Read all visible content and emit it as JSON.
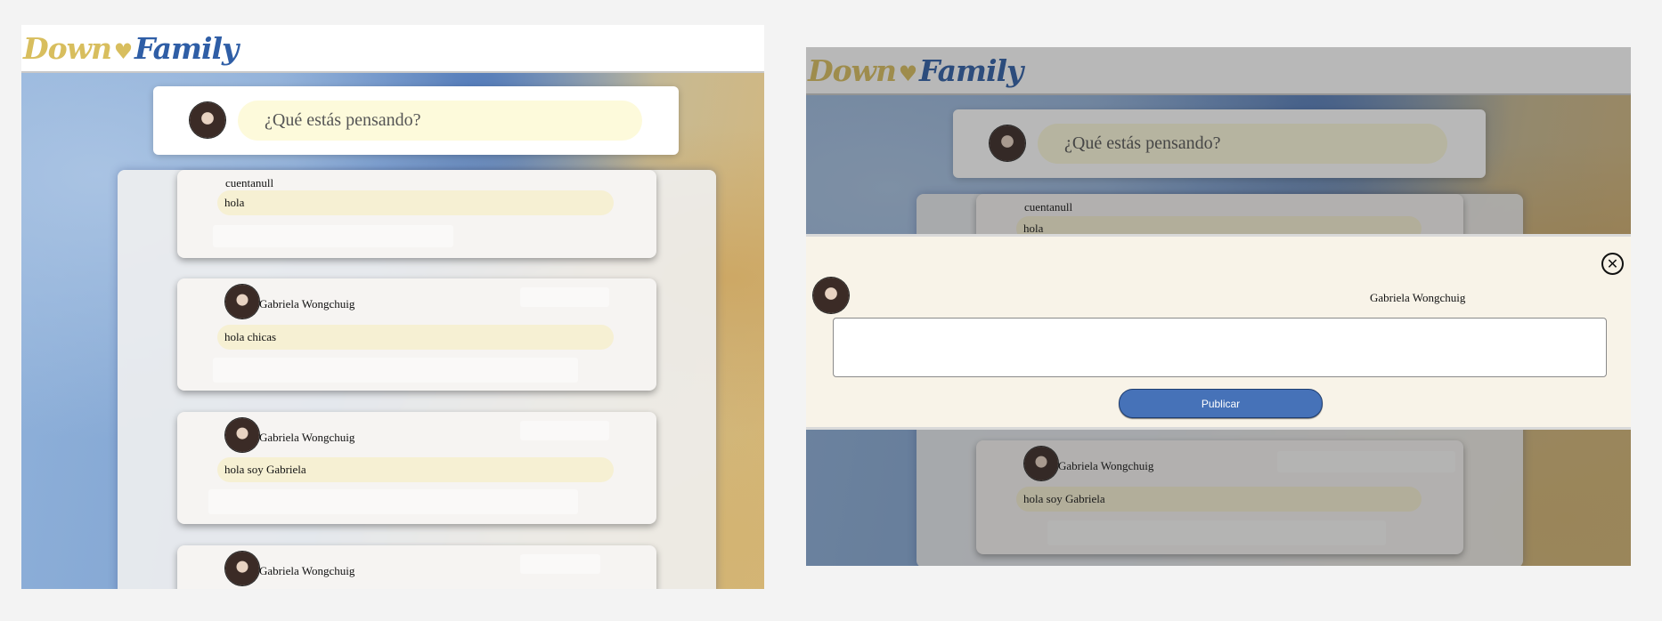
{
  "app": {
    "logo": {
      "part1": "Down",
      "part2": "Family"
    }
  },
  "composer": {
    "placeholder": "¿Qué estás pensando?"
  },
  "posts": [
    {
      "image_alt": "cuentanull",
      "message": "hola"
    },
    {
      "author": "Gabriela Wongchuig",
      "message": "hola chicas"
    },
    {
      "author": "Gabriela Wongchuig",
      "message": "hola soy Gabriela"
    },
    {
      "author": "Gabriela Wongchuig",
      "message": ""
    }
  ],
  "modal": {
    "author": "Gabriela Wongchuig",
    "textarea_value": "",
    "publish_label": "Publicar",
    "close_icon": "close-circle-icon"
  },
  "colors": {
    "brand_blue": "#2f5ea6",
    "brand_gold": "#d8be5e",
    "publish_button": "#4672b8",
    "modal_background": "#f8f3e8",
    "composer_pill": "#fdfadb"
  }
}
